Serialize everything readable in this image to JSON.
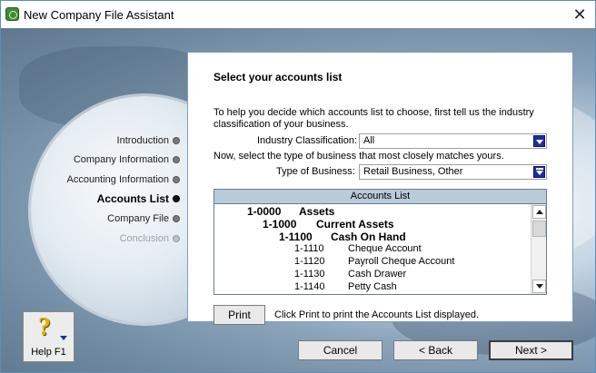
{
  "window": {
    "title": "New Company File Assistant"
  },
  "steps": [
    {
      "label": "Introduction",
      "state": "done"
    },
    {
      "label": "Company Information",
      "state": "done"
    },
    {
      "label": "Accounting Information",
      "state": "done"
    },
    {
      "label": "Accounts List",
      "state": "active"
    },
    {
      "label": "Company File",
      "state": "pending"
    },
    {
      "label": "Conclusion",
      "state": "disabled"
    }
  ],
  "panel": {
    "heading": "Select your accounts list",
    "intro": "To help you decide which accounts list to choose, first tell us the industry classification of your business.",
    "industry_label": "Industry Classification:",
    "industry_value": "All",
    "type_prompt": "Now, select the type of business that most closely matches yours.",
    "type_label": "Type of Business:",
    "type_value": "Retail Business, Other"
  },
  "accounts_list": {
    "header": "Accounts List",
    "rows": [
      {
        "code": "1-0000",
        "name": "Assets",
        "level": 0
      },
      {
        "code": "1-1000",
        "name": "Current Assets",
        "level": 1
      },
      {
        "code": "1-1100",
        "name": "Cash On Hand",
        "level": 2
      },
      {
        "code": "1-1110",
        "name": "Cheque Account",
        "level": 3
      },
      {
        "code": "1-1120",
        "name": "Payroll Cheque Account",
        "level": 3
      },
      {
        "code": "1-1130",
        "name": "Cash Drawer",
        "level": 3
      },
      {
        "code": "1-1140",
        "name": "Petty Cash",
        "level": 3
      }
    ]
  },
  "print": {
    "button": "Print",
    "note": "Click Print to print the Accounts List displayed."
  },
  "help": {
    "label": "Help F1"
  },
  "buttons": {
    "cancel": "Cancel",
    "back": "< Back",
    "next": "Next >"
  }
}
